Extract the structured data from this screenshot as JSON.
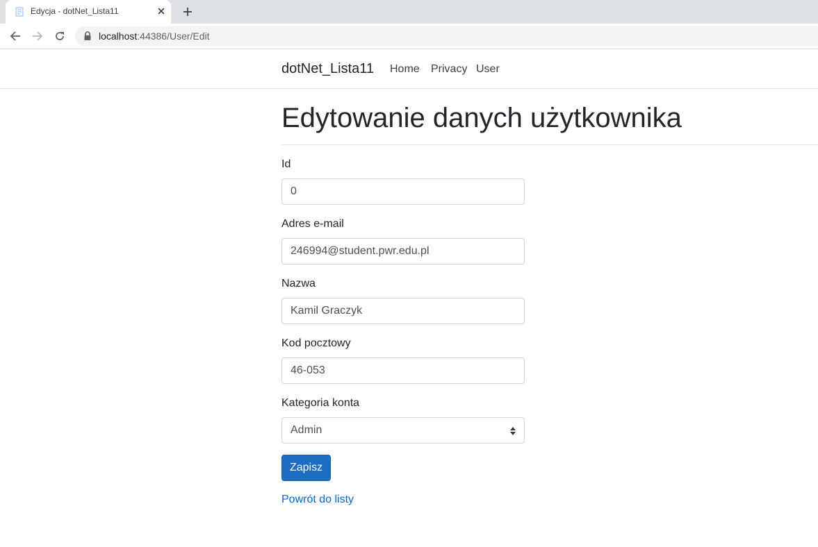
{
  "browser": {
    "tab_title": "Edycja - dotNet_Lista11",
    "url_host": "localhost",
    "url_rest": ":44386/User/Edit"
  },
  "navbar": {
    "brand": "dotNet_Lista11",
    "links": [
      "Home",
      "Privacy",
      "User"
    ]
  },
  "page": {
    "title": "Edytowanie danych użytkownika"
  },
  "form": {
    "fields": [
      {
        "label": "Id",
        "value": "0"
      },
      {
        "label": "Adres e-mail",
        "value": "246994@student.pwr.edu.pl"
      },
      {
        "label": "Nazwa",
        "value": "Kamil Graczyk"
      },
      {
        "label": "Kod pocztowy",
        "value": "46-053"
      }
    ],
    "category_label": "Kategoria konta",
    "category_value": "Admin",
    "submit_label": "Zapisz",
    "back_link": "Powrót do listy"
  },
  "colors": {
    "primary_button": "#1b6ec2",
    "link": "#0366d6"
  },
  "icons": {
    "tab": "document-favicon-icon",
    "close": "close-icon",
    "new_tab": "plus-icon",
    "back": "arrow-left-icon",
    "forward": "arrow-right-icon",
    "reload": "reload-icon",
    "lock": "lock-icon",
    "select": "select-arrows-icon"
  }
}
